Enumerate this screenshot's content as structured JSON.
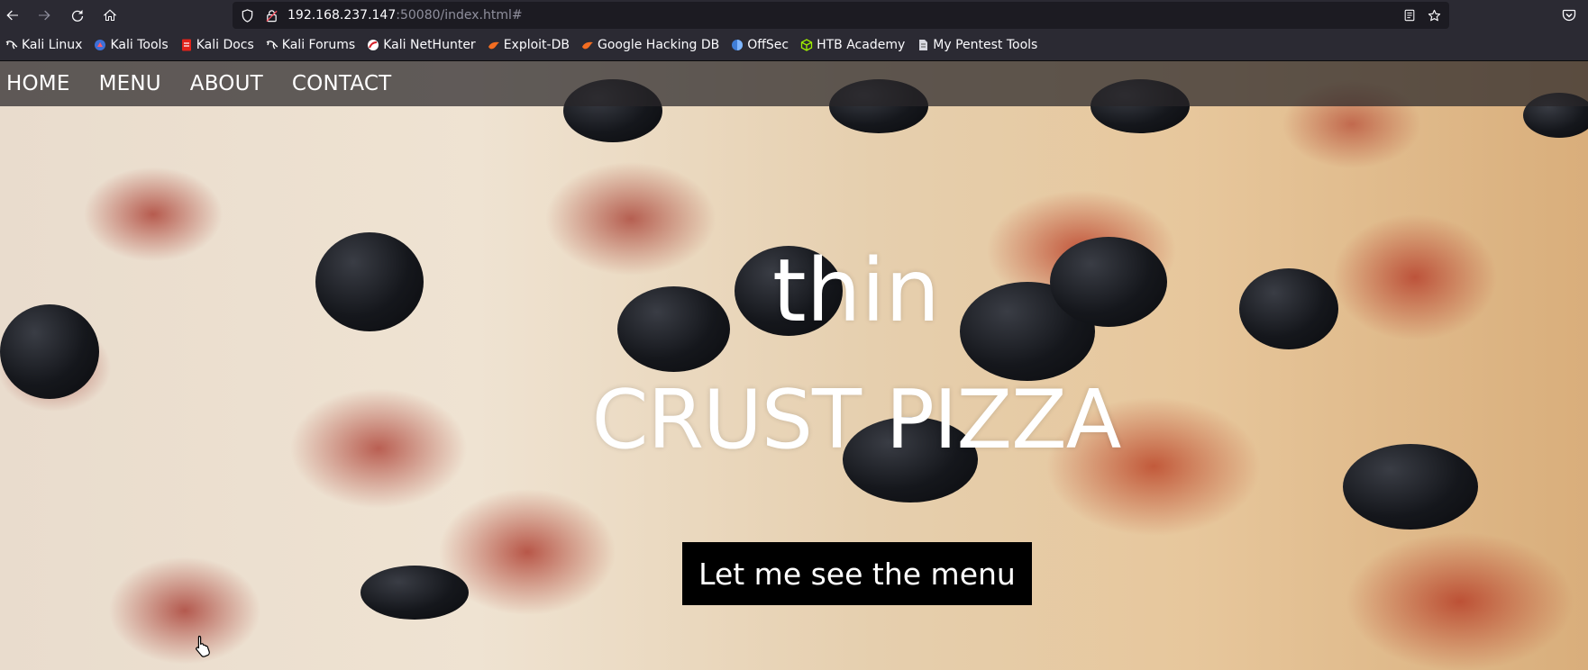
{
  "browser": {
    "url": {
      "host": "192.168.237.147",
      "rest": ":50080/index.html#"
    },
    "bookmarks": [
      {
        "label": "Kali Linux",
        "icon": "kali-dragon-icon"
      },
      {
        "label": "Kali Tools",
        "icon": "kali-tools-icon"
      },
      {
        "label": "Kali Docs",
        "icon": "kali-docs-icon"
      },
      {
        "label": "Kali Forums",
        "icon": "kali-dragon-icon"
      },
      {
        "label": "Kali NetHunter",
        "icon": "nethunter-icon"
      },
      {
        "label": "Exploit-DB",
        "icon": "exploitdb-icon"
      },
      {
        "label": "Google Hacking DB",
        "icon": "ghdb-icon"
      },
      {
        "label": "OffSec",
        "icon": "offsec-icon"
      },
      {
        "label": "HTB Academy",
        "icon": "htb-cube-icon"
      },
      {
        "label": "My Pentest Tools",
        "icon": "pentest-tools-icon"
      }
    ]
  },
  "site": {
    "nav": [
      "HOME",
      "MENU",
      "ABOUT",
      "CONTACT"
    ],
    "hero": {
      "line1": "thin",
      "line2": "CRUST PIZZA",
      "button": "Let me see the menu"
    }
  },
  "colors": {
    "chrome_bg": "#2b2a33",
    "urlbar_bg": "#1c1b22",
    "navbar_bg": "rgba(40,38,40,0.72)",
    "button_bg": "#000000",
    "text": "#ffffff"
  }
}
